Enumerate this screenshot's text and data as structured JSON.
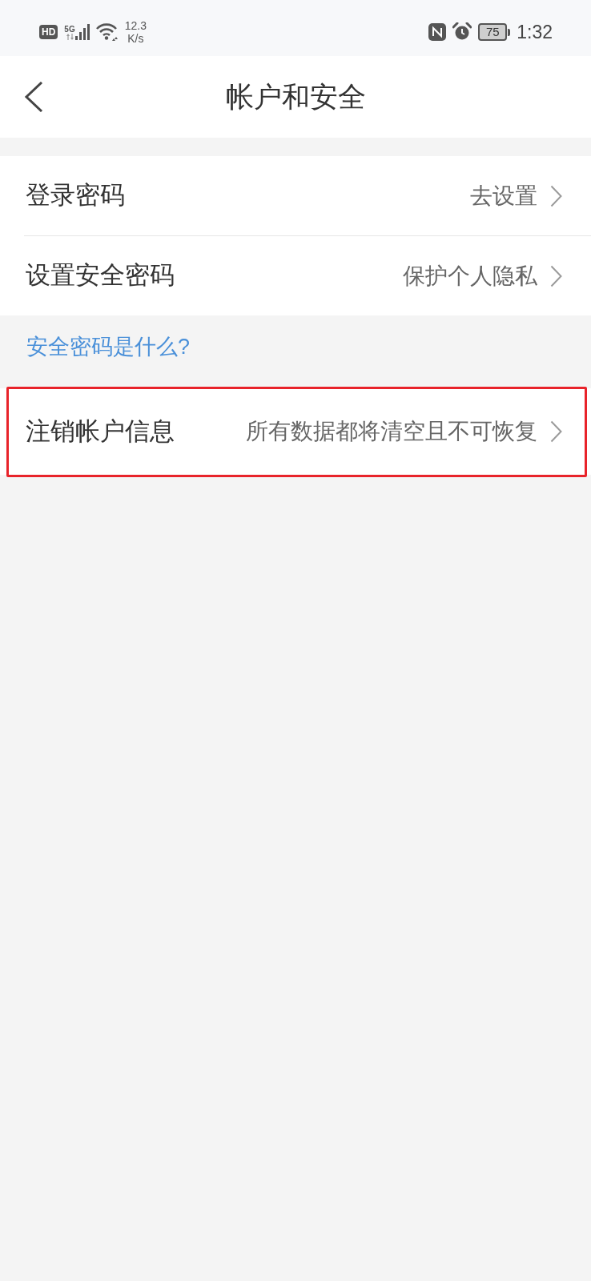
{
  "status_bar": {
    "hd_label": "HD",
    "network_type": "5G",
    "speed_value": "12.3",
    "speed_unit": "K/s",
    "battery": "75",
    "time": "1:32"
  },
  "header": {
    "title": "帐户和安全"
  },
  "security_rows": [
    {
      "label": "登录密码",
      "value": "去设置",
      "highlighted": false
    },
    {
      "label": "设置安全密码",
      "value": "保护个人隐私",
      "highlighted": false
    }
  ],
  "help_link": "安全密码是什么?",
  "account_rows": [
    {
      "label": "注销帐户信息",
      "value": "所有数据都将清空且不可恢复",
      "highlighted": true
    }
  ]
}
